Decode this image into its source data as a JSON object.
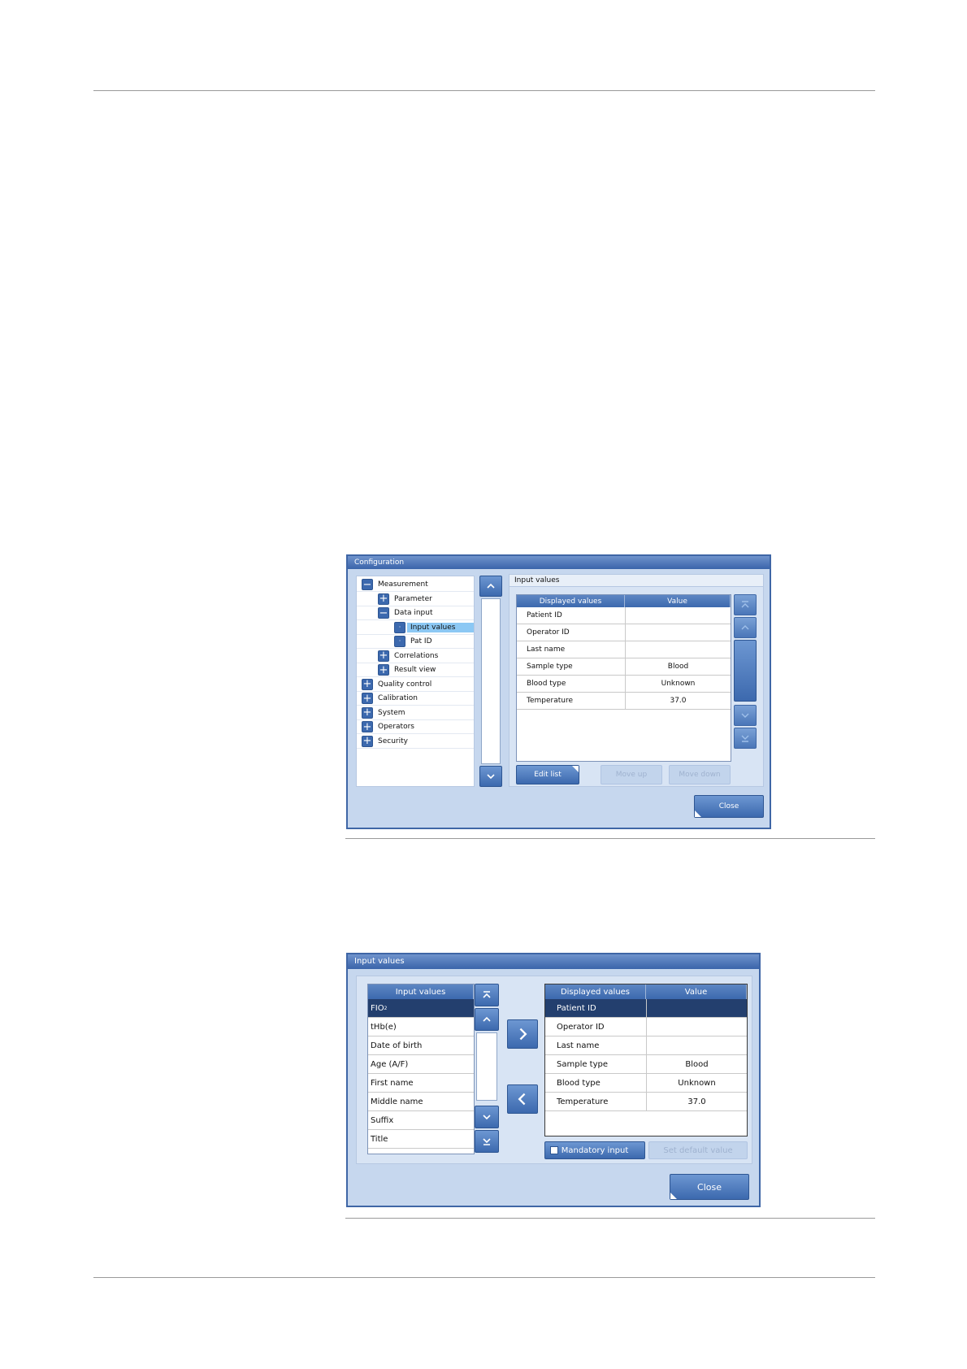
{
  "configuration_window": {
    "title": "Configuration",
    "tree": [
      {
        "label": "Measurement",
        "state": "minus"
      },
      {
        "label": "Parameter",
        "state": "plus"
      },
      {
        "label": "Data input",
        "state": "minus"
      },
      {
        "label": "Input values",
        "state": "dot",
        "selected": true
      },
      {
        "label": "Pat ID",
        "state": "dot"
      },
      {
        "label": "Correlations",
        "state": "plus"
      },
      {
        "label": "Result view",
        "state": "plus"
      },
      {
        "label": "Quality control",
        "state": "plus"
      },
      {
        "label": "Calibration",
        "state": "plus"
      },
      {
        "label": "System",
        "state": "plus"
      },
      {
        "label": "Operators",
        "state": "plus"
      },
      {
        "label": "Security",
        "state": "plus"
      }
    ],
    "panel_title": "Input values",
    "table": {
      "headers": [
        "Displayed values",
        "Value"
      ],
      "rows": [
        [
          "Patient ID",
          ""
        ],
        [
          "Operator ID",
          ""
        ],
        [
          "Last name",
          ""
        ],
        [
          "Sample type",
          "Blood"
        ],
        [
          "Blood type",
          "Unknown"
        ],
        [
          "Temperature",
          "37.0"
        ]
      ]
    },
    "buttons": {
      "edit_list": "Edit list",
      "move_up": "Move up",
      "move_down": "Move down",
      "close": "Close"
    }
  },
  "input_values_window": {
    "title": "Input values",
    "left_header": "Input values",
    "left_items": [
      "FIO",
      "tHb(e)",
      "Date of birth",
      "Age (A/F)",
      "First name",
      "Middle name",
      "Suffix",
      "Title"
    ],
    "left_first_subscript": "2",
    "right_headers": [
      "Displayed values",
      "Value"
    ],
    "right_rows": [
      [
        "Patient ID",
        ""
      ],
      [
        "Operator ID",
        ""
      ],
      [
        "Last name",
        ""
      ],
      [
        "Sample type",
        "Blood"
      ],
      [
        "Blood type",
        "Unknown"
      ],
      [
        "Temperature",
        "37.0"
      ]
    ],
    "buttons": {
      "mandatory_input": "Mandatory input",
      "set_default_value": "Set default value",
      "close": "Close"
    }
  },
  "colors": {
    "window_bg": "#c6d7ee",
    "button_blue": "#3c69ae",
    "selected_row": "#233f6e",
    "tree_selected": "#8cc8f4"
  }
}
